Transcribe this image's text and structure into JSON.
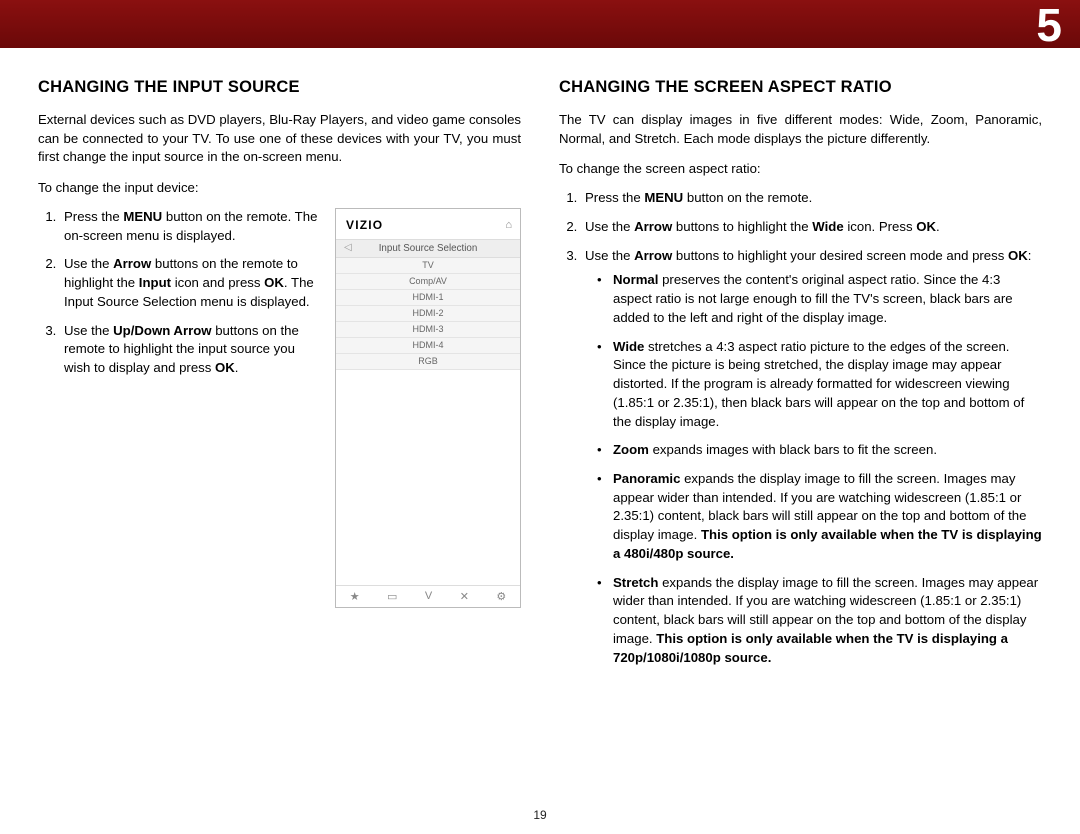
{
  "chapter": "5",
  "page_number": "19",
  "left": {
    "heading": "CHANGING THE INPUT SOURCE",
    "intro": "External devices such as DVD players, Blu-Ray Players, and video game consoles can be connected to your TV. To use one of these devices with your TV, you must first change the input source in the on-screen menu.",
    "lead": "To change the input device:",
    "steps": {
      "s1a": "Press the ",
      "s1_menu": "MENU",
      "s1b": " button on the remote. The on-screen menu is displayed.",
      "s2a": "Use the ",
      "s2_arrow": "Arrow",
      "s2b": " buttons on the remote to highlight the ",
      "s2_input": "Input",
      "s2c": " icon and press ",
      "s2_ok": "OK",
      "s2d": ". The Input Source Selection menu is displayed.",
      "s3a": "Use the ",
      "s3_ud": "Up/Down Arrow",
      "s3b": " buttons on the remote to highlight the input source you wish to display and press ",
      "s3_ok": "OK",
      "s3c": "."
    },
    "menu": {
      "logo": "VIZIO",
      "title": "Input Source Selection",
      "rows": [
        "TV",
        "Comp/AV",
        "HDMI-1",
        "HDMI-2",
        "HDMI-3",
        "HDMI-4",
        "RGB"
      ],
      "footer_icons": [
        "★",
        "▭",
        "V",
        "✕",
        "⚙"
      ]
    }
  },
  "right": {
    "heading": "CHANGING THE SCREEN ASPECT RATIO",
    "intro": "The TV can display images in five different modes: Wide, Zoom, Panoramic, Normal, and Stretch. Each mode displays the picture differently.",
    "lead": "To change the screen aspect ratio:",
    "steps": {
      "s1a": "Press the ",
      "s1_menu": "MENU",
      "s1b": " button on the remote.",
      "s2a": "Use the ",
      "s2_arrow": "Arrow",
      "s2b": " buttons to highlight the ",
      "s2_wide": "Wide",
      "s2c": " icon. Press ",
      "s2_ok": "OK",
      "s2d": ".",
      "s3a": "Use the ",
      "s3_arrow": "Arrow",
      "s3b": " buttons to highlight your desired screen mode and press ",
      "s3_ok": "OK",
      "s3c": ":"
    },
    "modes": {
      "normal_l": "Normal",
      "normal_t": " preserves the content's original aspect ratio. Since the 4:3 aspect ratio is not large enough to fill the TV's screen, black bars are added to the left and right of the display image.",
      "wide_l": "Wide",
      "wide_t": " stretches a 4:3 aspect ratio picture to the edges of the screen. Since the picture is being stretched, the display image may appear distorted. If the program is already formatted for widescreen viewing (1.85:1 or 2.35:1), then black bars will appear on the top and bottom of the display image.",
      "zoom_l": "Zoom",
      "zoom_t": " expands images with black bars to fit the screen.",
      "pano_l": "Panoramic",
      "pano_t": " expands the display image to fill the screen. Images may appear wider than intended. If you are watching widescreen (1.85:1 or 2.35:1) content, black bars will still appear on the top and bottom of the display image. ",
      "pano_note": "This option is only available when the TV is displaying a 480i/480p source.",
      "stretch_l": "Stretch",
      "stretch_t": " expands the display image to fill the screen. Images may appear wider than intended. If you are watching widescreen (1.85:1 or 2.35:1) content, black bars will still appear on the top and bottom of the display image. ",
      "stretch_note": "This option is only available when the TV is displaying a 720p/1080i/1080p source."
    }
  }
}
